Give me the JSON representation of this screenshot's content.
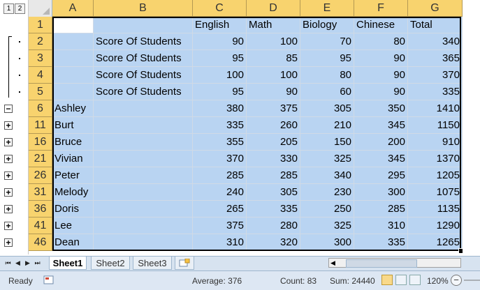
{
  "outline": {
    "level_buttons": [
      "1",
      "2"
    ],
    "expanded_symbol": "−",
    "collapsed_symbol": "+"
  },
  "columns": [
    "A",
    "B",
    "C",
    "D",
    "E",
    "F",
    "G"
  ],
  "rows": [
    {
      "num": "1",
      "a": "",
      "b": "",
      "c": "English",
      "d": "Math",
      "e": "Biology",
      "f": "Chinese",
      "g": "Total",
      "header": true,
      "group": "none"
    },
    {
      "num": "2",
      "a": "",
      "b": "Score Of Students",
      "c": "90",
      "d": "100",
      "e": "70",
      "f": "80",
      "g": "340",
      "group": "detail"
    },
    {
      "num": "3",
      "a": "",
      "b": "Score Of Students",
      "c": "95",
      "d": "85",
      "e": "95",
      "f": "90",
      "g": "365",
      "group": "detail"
    },
    {
      "num": "4",
      "a": "",
      "b": "Score Of Students",
      "c": "100",
      "d": "100",
      "e": "80",
      "f": "90",
      "g": "370",
      "group": "detail"
    },
    {
      "num": "5",
      "a": "",
      "b": "Score Of Students",
      "c": "95",
      "d": "90",
      "e": "60",
      "f": "90",
      "g": "335",
      "group": "detail"
    },
    {
      "num": "6",
      "a": "Ashley",
      "b": "",
      "c": "380",
      "d": "375",
      "e": "305",
      "f": "350",
      "g": "1410",
      "group": "expanded"
    },
    {
      "num": "11",
      "a": "Burt",
      "b": "",
      "c": "335",
      "d": "260",
      "e": "210",
      "f": "345",
      "g": "1150",
      "group": "collapsed"
    },
    {
      "num": "16",
      "a": "Bruce",
      "b": "",
      "c": "355",
      "d": "205",
      "e": "150",
      "f": "200",
      "g": "910",
      "group": "collapsed"
    },
    {
      "num": "21",
      "a": "Vivian",
      "b": "",
      "c": "370",
      "d": "330",
      "e": "325",
      "f": "345",
      "g": "1370",
      "group": "collapsed"
    },
    {
      "num": "26",
      "a": "Peter",
      "b": "",
      "c": "285",
      "d": "285",
      "e": "340",
      "f": "295",
      "g": "1205",
      "group": "collapsed"
    },
    {
      "num": "31",
      "a": "Melody",
      "b": "",
      "c": "240",
      "d": "305",
      "e": "230",
      "f": "300",
      "g": "1075",
      "group": "collapsed"
    },
    {
      "num": "36",
      "a": "Doris",
      "b": "",
      "c": "265",
      "d": "335",
      "e": "250",
      "f": "285",
      "g": "1135",
      "group": "collapsed"
    },
    {
      "num": "41",
      "a": "Lee",
      "b": "",
      "c": "375",
      "d": "280",
      "e": "325",
      "f": "310",
      "g": "1290",
      "group": "collapsed"
    },
    {
      "num": "46",
      "a": "Dean",
      "b": "",
      "c": "310",
      "d": "320",
      "e": "300",
      "f": "335",
      "g": "1265",
      "group": "collapsed"
    }
  ],
  "sheet_tabs": [
    "Sheet1",
    "Sheet2",
    "Sheet3"
  ],
  "active_sheet": "Sheet1",
  "status": {
    "ready": "Ready",
    "average": "Average: 376",
    "count": "Count: 83",
    "sum": "Sum: 24440",
    "zoom": "120%"
  },
  "icons": {
    "nav_first": "first-sheet-icon",
    "nav_prev": "prev-sheet-icon",
    "nav_next": "next-sheet-icon",
    "nav_last": "last-sheet-icon",
    "insert_sheet": "insert-sheet-icon",
    "macro": "macro-record-icon",
    "zoom_out": "zoom-out-icon"
  },
  "colors": {
    "selection": "#b9d4f2",
    "header_highlight": "#f8d36e",
    "statusbar": "#dde7f3"
  }
}
